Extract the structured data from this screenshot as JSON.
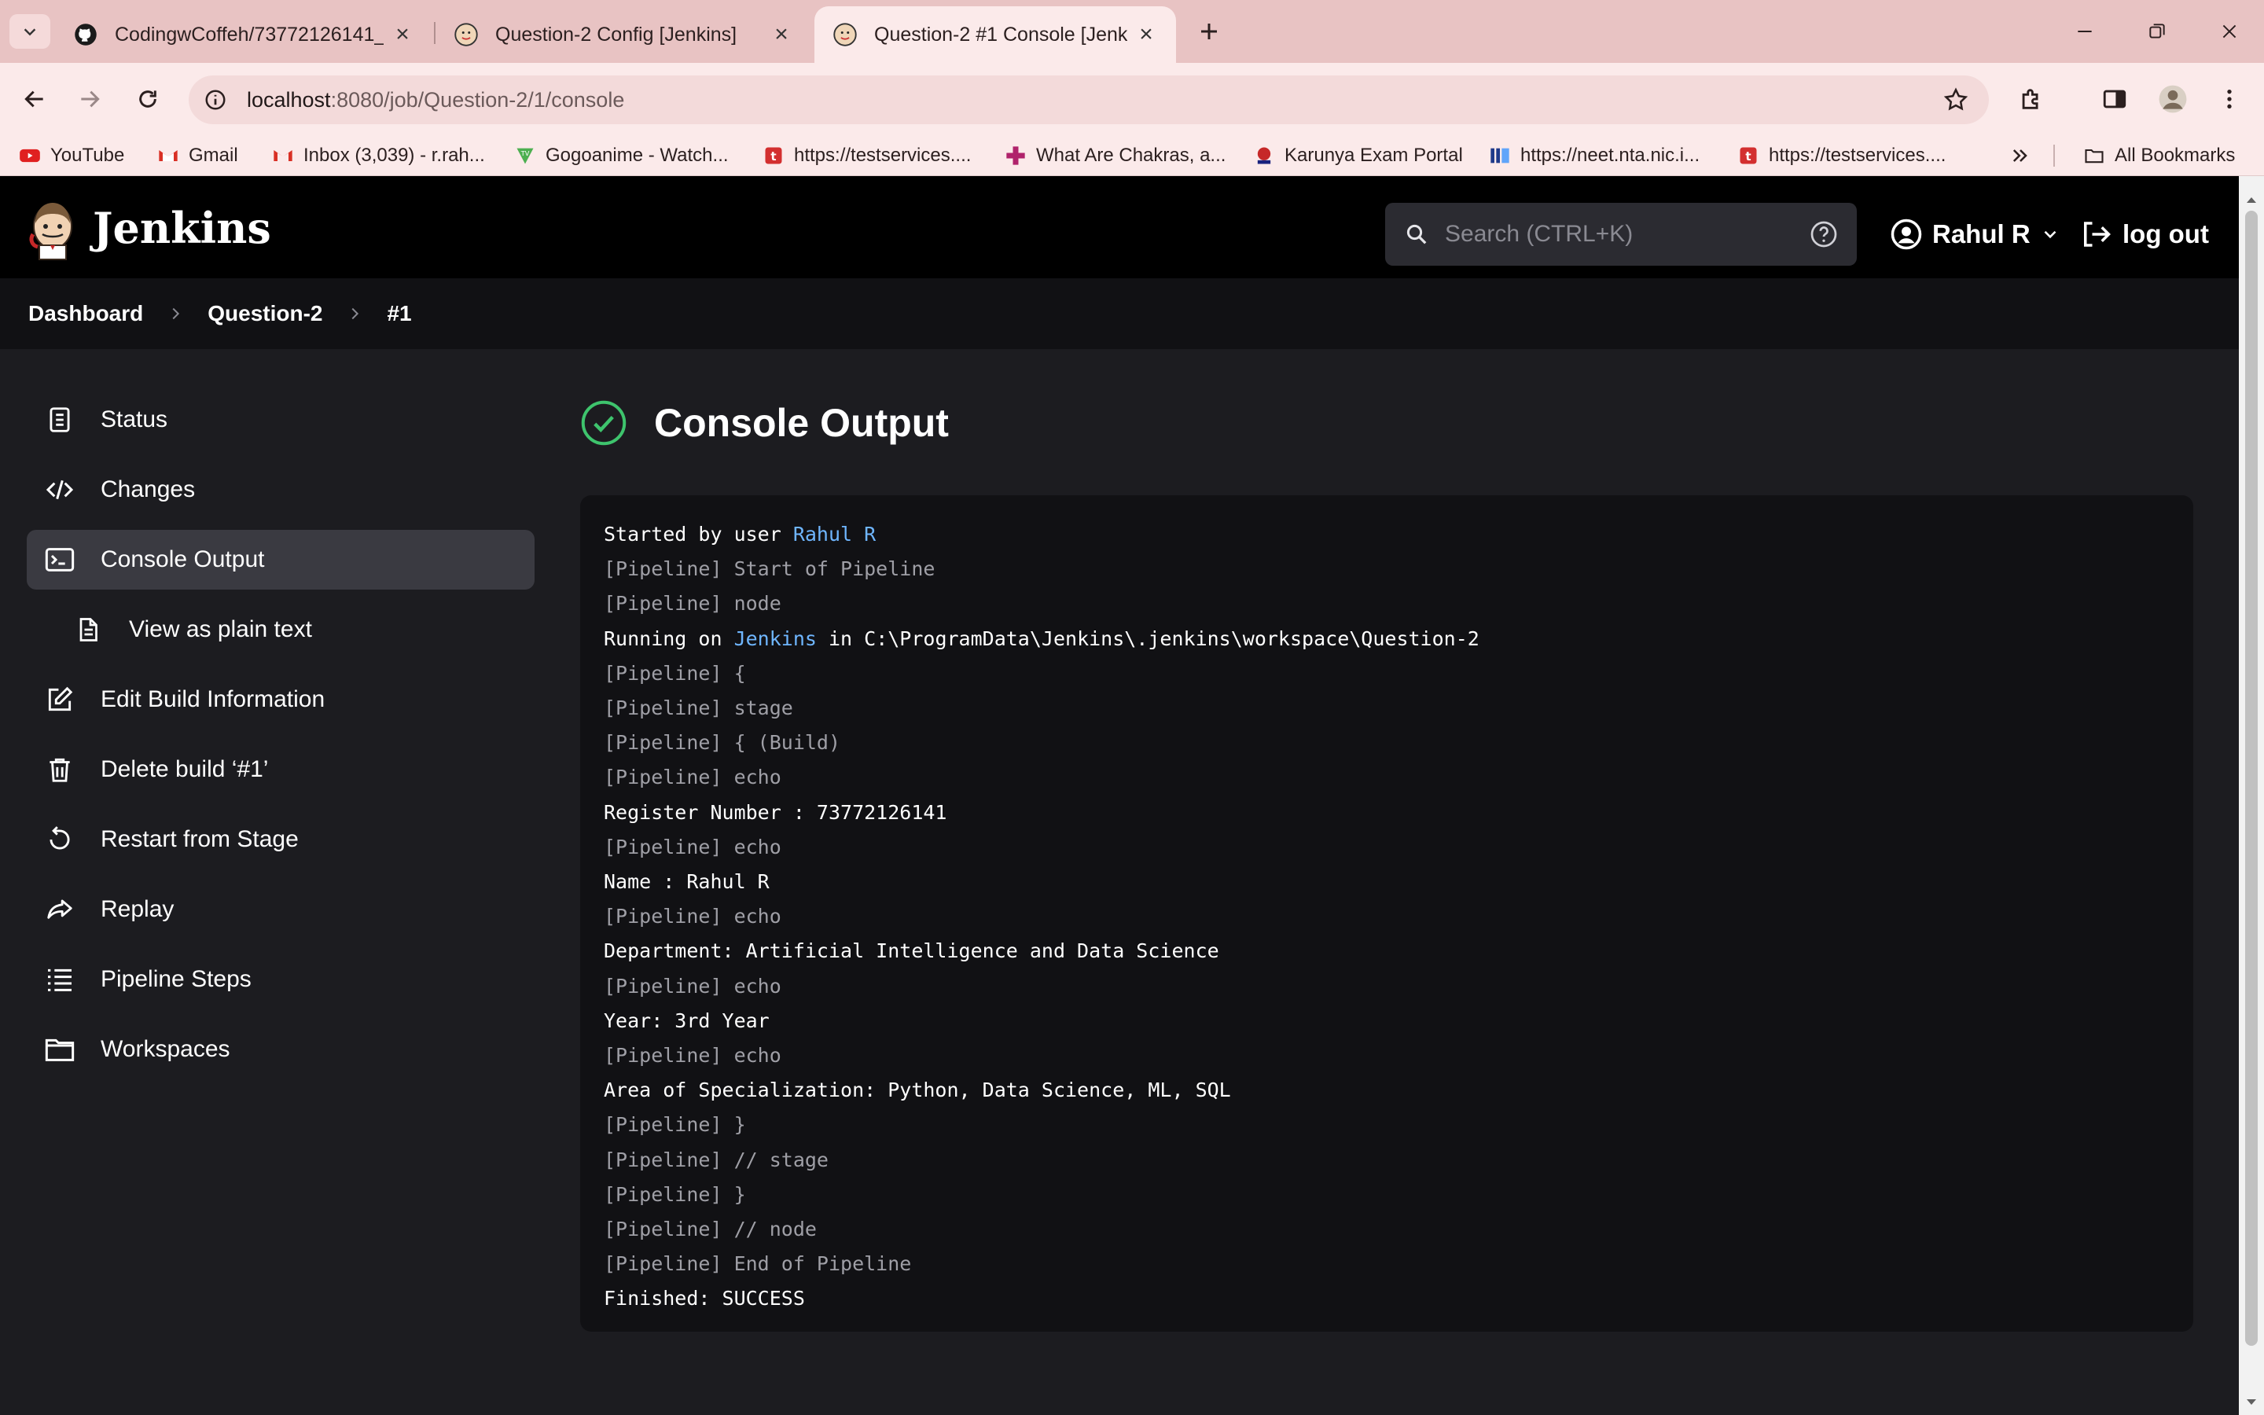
{
  "browser": {
    "tabs": [
      {
        "title": "CodingwCoffeh/73772126141_",
        "icon": "github-icon",
        "active": false
      },
      {
        "title": "Question-2 Config [Jenkins]",
        "icon": "jenkins-icon",
        "active": false
      },
      {
        "title": "Question-2 #1 Console [Jenkins",
        "icon": "jenkins-icon",
        "active": true
      }
    ],
    "url_host": "localhost",
    "url_path": ":8080/job/Question-2/1/console",
    "bookmarks": [
      {
        "label": "YouTube",
        "icon": "youtube-icon"
      },
      {
        "label": "Gmail",
        "icon": "gmail-icon"
      },
      {
        "label": "Inbox (3,039) - r.rah...",
        "icon": "gmail-icon"
      },
      {
        "label": "Gogoanime - Watch...",
        "icon": "gogoanime-icon"
      },
      {
        "label": "https://testservices....",
        "icon": "testservices-icon"
      },
      {
        "label": "What Are Chakras, a...",
        "icon": "cross-icon"
      },
      {
        "label": "Karunya Exam Portal",
        "icon": "karunya-icon"
      },
      {
        "label": "https://neet.nta.nic.i...",
        "icon": "nic-icon"
      },
      {
        "label": "https://testservices....",
        "icon": "testservices-icon"
      }
    ],
    "all_bookmarks": "All Bookmarks"
  },
  "jenkins": {
    "title": "Jenkins",
    "search_placeholder": "Search (CTRL+K)",
    "user": "Rahul R",
    "logout": "log out"
  },
  "breadcrumb": [
    "Dashboard",
    "Question-2",
    "#1"
  ],
  "sidebar": [
    {
      "label": "Status",
      "icon": "document-icon",
      "active": false,
      "sub": false
    },
    {
      "label": "Changes",
      "icon": "code-icon",
      "active": false,
      "sub": false
    },
    {
      "label": "Console Output",
      "icon": "terminal-icon",
      "active": true,
      "sub": false
    },
    {
      "label": "View as plain text",
      "icon": "file-text-icon",
      "active": false,
      "sub": true
    },
    {
      "label": "Edit Build Information",
      "icon": "edit-icon",
      "active": false,
      "sub": false
    },
    {
      "label": "Delete build ‘#1’",
      "icon": "trash-icon",
      "active": false,
      "sub": false
    },
    {
      "label": "Restart from Stage",
      "icon": "restart-icon",
      "active": false,
      "sub": false
    },
    {
      "label": "Replay",
      "icon": "replay-icon",
      "active": false,
      "sub": false
    },
    {
      "label": "Pipeline Steps",
      "icon": "list-icon",
      "active": false,
      "sub": false
    },
    {
      "label": "Workspaces",
      "icon": "folder-icon",
      "active": false,
      "sub": false
    }
  ],
  "page_title": "Console Output",
  "console": [
    {
      "text": "Started by user ",
      "link": "Rahul R",
      "after": "",
      "pipe": false
    },
    {
      "text": "[Pipeline] Start of Pipeline",
      "pipe": true
    },
    {
      "text": "[Pipeline] node",
      "pipe": true
    },
    {
      "text": "Running on ",
      "link": "Jenkins",
      "after": " in C:\\ProgramData\\Jenkins\\.jenkins\\workspace\\Question-2",
      "pipe": false
    },
    {
      "text": "[Pipeline] {",
      "pipe": true
    },
    {
      "text": "[Pipeline] stage",
      "pipe": true
    },
    {
      "text": "[Pipeline] { (Build)",
      "pipe": true
    },
    {
      "text": "[Pipeline] echo",
      "pipe": true
    },
    {
      "text": "Register Number : 73772126141",
      "pipe": false
    },
    {
      "text": "[Pipeline] echo",
      "pipe": true
    },
    {
      "text": "Name : Rahul R",
      "pipe": false
    },
    {
      "text": "[Pipeline] echo",
      "pipe": true
    },
    {
      "text": "Department: Artificial Intelligence and Data Science",
      "pipe": false
    },
    {
      "text": "[Pipeline] echo",
      "pipe": true
    },
    {
      "text": "Year: 3rd Year",
      "pipe": false
    },
    {
      "text": "[Pipeline] echo",
      "pipe": true
    },
    {
      "text": "Area of Specialization: Python, Data Science, ML, SQL",
      "pipe": false
    },
    {
      "text": "[Pipeline] }",
      "pipe": true
    },
    {
      "text": "[Pipeline] // stage",
      "pipe": true
    },
    {
      "text": "[Pipeline] }",
      "pipe": true
    },
    {
      "text": "[Pipeline] // node",
      "pipe": true
    },
    {
      "text": "[Pipeline] End of Pipeline",
      "pipe": true
    },
    {
      "text": "Finished: SUCCESS",
      "pipe": false
    }
  ],
  "colors": {
    "link": "#6fb6ff",
    "success": "#3ec46d",
    "tabstrip": "#e8c3c3"
  }
}
